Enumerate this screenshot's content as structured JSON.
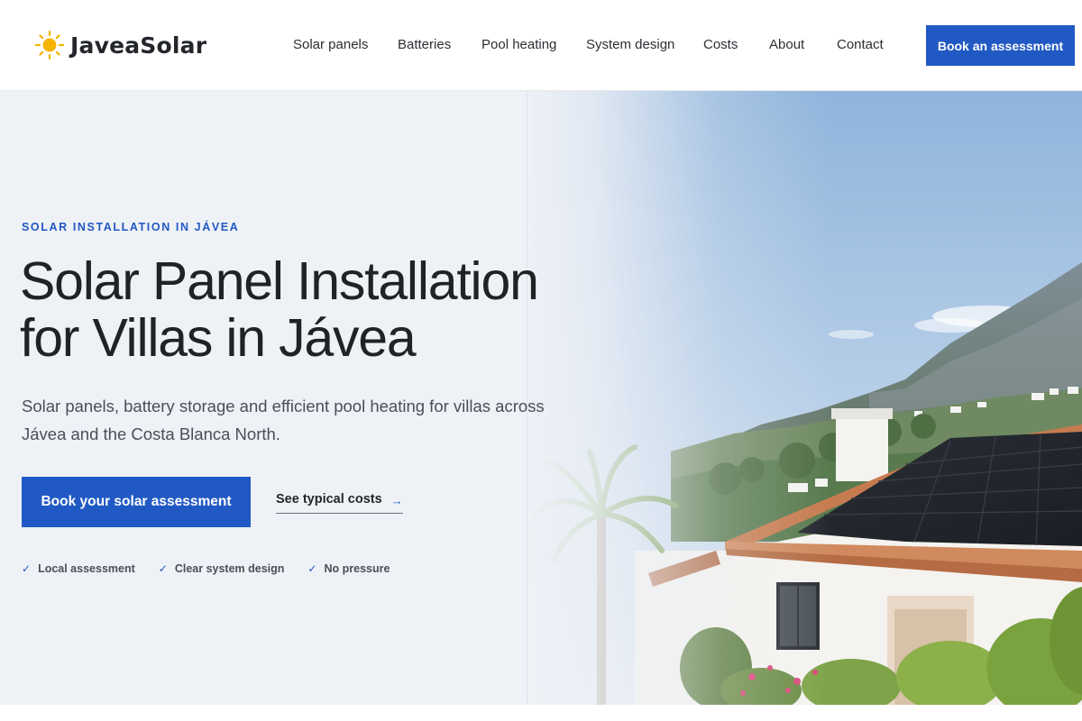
{
  "brand": {
    "name": "JaveaSolar",
    "icon": "sun-icon",
    "accent": "#F6B400"
  },
  "nav": {
    "items": [
      {
        "label": "Solar panels"
      },
      {
        "label": "Batteries"
      },
      {
        "label": "Pool heating"
      },
      {
        "label": "System design"
      },
      {
        "label": "Costs"
      },
      {
        "label": "About"
      },
      {
        "label": "Contact"
      }
    ],
    "cta_label": "Book an assessment"
  },
  "hero": {
    "eyebrow": "SOLAR INSTALLATION IN JÁVEA",
    "title_line1": "Solar Panel Installation",
    "title_line2": "for Villas in Jávea",
    "subtitle": "Solar panels, battery storage and efficient pool heating for villas across Jávea and the Costa Blanca North.",
    "primary_cta": "Book your solar assessment",
    "secondary_cta": "See typical costs",
    "secondary_cta_icon": "arrow-right-icon",
    "checks": [
      {
        "label": "Local assessment"
      },
      {
        "label": "Clear system design"
      },
      {
        "label": "No pressure"
      }
    ]
  },
  "colors": {
    "primary": "#2159C4",
    "hero_background": "#EEF1F6",
    "text": "#1F2226"
  }
}
